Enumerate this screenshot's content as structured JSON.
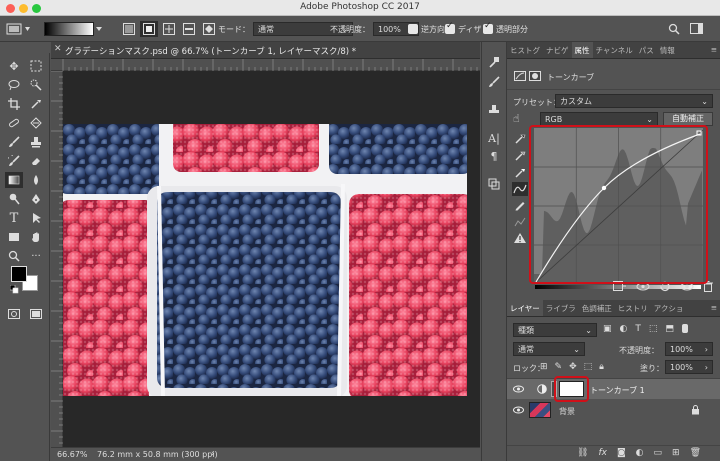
{
  "app": {
    "title": "Adobe Photoshop CC 2017"
  },
  "options": {
    "mode_label": "モード：",
    "mode_value": "通常",
    "opacity_label": "不透明度：",
    "opacity_value": "100%",
    "reverse_label": "逆方向",
    "dither_label": "ディザ",
    "transparency_label": "透明部分",
    "reverse_checked": false,
    "dither_checked": true,
    "transparency_checked": true
  },
  "document": {
    "tab_title": "グラデーションマスク.psd @ 66.7% (トーンカーブ 1, レイヤーマスク/8) *",
    "zoom": "66.67%",
    "doc_info": "76.2 mm x 50.8 mm (300 ppi)"
  },
  "panel_tabs": [
    "ヒストグラム",
    "ナビゲーター",
    "属性",
    "チャンネル",
    "パス",
    "情報"
  ],
  "panel_tabs_display": [
    "ヒストグ",
    "ナビゲ",
    "属性",
    "チャンネル",
    "パス",
    "情報"
  ],
  "properties": {
    "header": "トーンカーブ",
    "preset_label": "プリセット：",
    "preset_value": "カスタム",
    "channel_value": "RGB",
    "auto_button": "自動補正"
  },
  "layers_tabs": [
    "レイヤー",
    "ライブラリ",
    "色調補正",
    "ヒストリー",
    "アクション"
  ],
  "layers_tabs_display": [
    "レイヤー",
    "ライブラ",
    "色調補正",
    "ヒストリ",
    "アクショ"
  ],
  "layers": {
    "filter_value": "種類",
    "blend_value": "通常",
    "opacity_label": "不透明度：",
    "opacity_value": "100%",
    "lock_label": "ロック：",
    "fill_label": "塗り：",
    "fill_value": "100%",
    "items": [
      {
        "name": "トーンカーブ 1",
        "selected": true
      },
      {
        "name": "背景",
        "selected": false
      }
    ]
  },
  "colors": {
    "highlight": "#d01019",
    "foreground": "#000000",
    "background": "#ffffff"
  }
}
